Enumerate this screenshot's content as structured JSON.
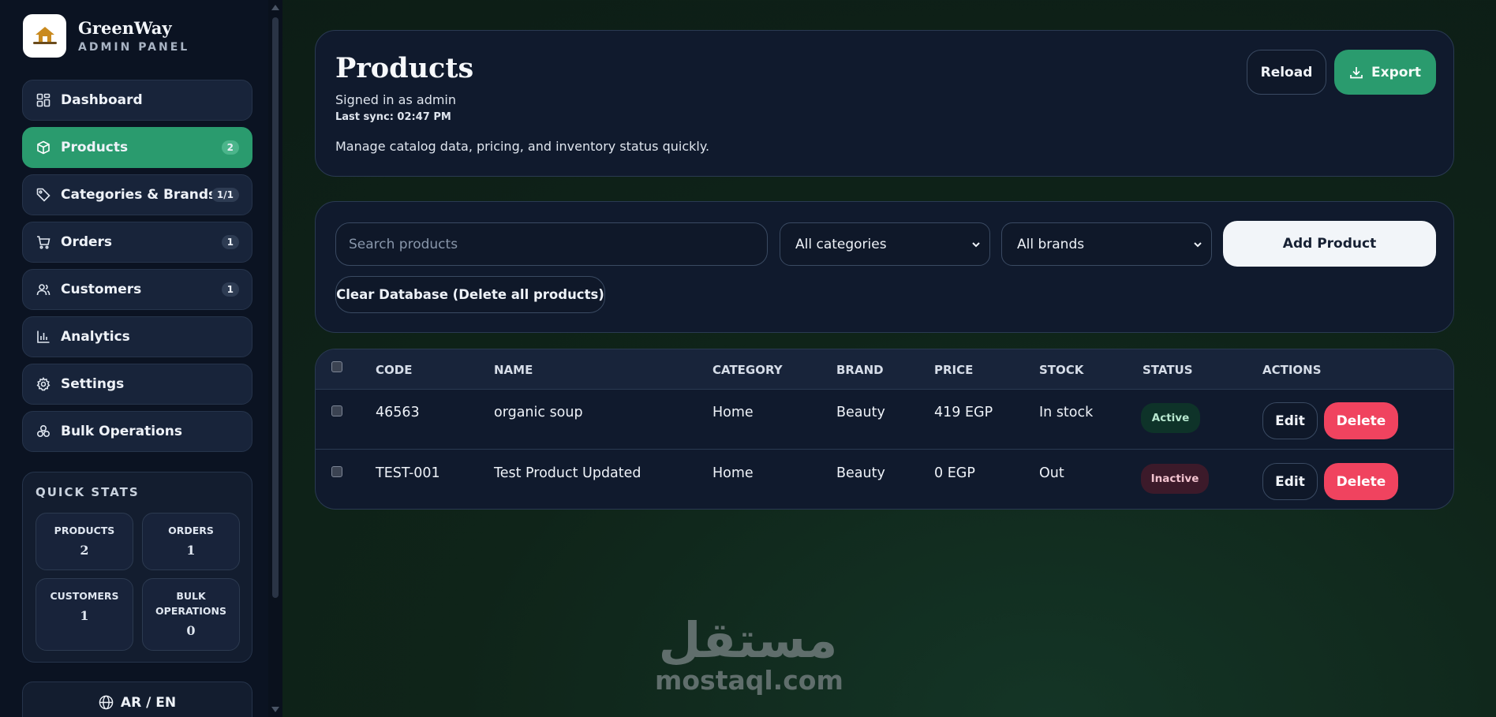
{
  "brand": {
    "name": "GreenWay",
    "subtitle": "ADMIN PANEL",
    "logo_icon": "house-logo-icon"
  },
  "sidebar": {
    "items": [
      {
        "label": "Dashboard",
        "icon": "grid-icon",
        "badge": null
      },
      {
        "label": "Products",
        "icon": "box-icon",
        "badge": "2",
        "active": true
      },
      {
        "label": "Categories & Brands",
        "icon": "tag-icon",
        "badge": "1/1"
      },
      {
        "label": "Orders",
        "icon": "cart-icon",
        "badge": "1"
      },
      {
        "label": "Customers",
        "icon": "users-icon",
        "badge": "1"
      },
      {
        "label": "Analytics",
        "icon": "bar-chart-icon",
        "badge": null
      },
      {
        "label": "Settings",
        "icon": "gear-icon",
        "badge": null
      },
      {
        "label": "Bulk Operations",
        "icon": "layers-icon",
        "badge": null
      }
    ],
    "quick_stats": {
      "title": "QUICK STATS",
      "products_label": "PRODUCTS",
      "products_value": "2",
      "orders_label": "ORDERS",
      "orders_value": "1",
      "customers_label": "CUSTOMERS",
      "customers_value": "1",
      "bulk_label_1": "BULK",
      "bulk_label_2": "OPERATIONS",
      "bulk_value": "0"
    },
    "language_toggle": "AR / EN"
  },
  "header": {
    "title": "Products",
    "signed_in": "Signed in as admin",
    "last_sync": "Last sync: 02:47 PM",
    "description": "Manage catalog data, pricing, and inventory status quickly.",
    "reload_label": "Reload",
    "export_label": "Export"
  },
  "filters": {
    "search_placeholder": "Search products",
    "category_selected": "All categories",
    "brand_selected": "All brands",
    "add_label": "Add Product",
    "clear_label": "Clear Database (Delete all products)"
  },
  "table": {
    "columns": [
      "CODE",
      "NAME",
      "CATEGORY",
      "BRAND",
      "PRICE",
      "STOCK",
      "STATUS",
      "ACTIONS"
    ],
    "rows": [
      {
        "code": "46563",
        "name": "organic soup",
        "category": "Home",
        "brand": "Beauty",
        "price": "419 EGP",
        "stock": "In stock",
        "status": "Active"
      },
      {
        "code": "TEST-001",
        "name": "Test Product Updated",
        "category": "Home",
        "brand": "Beauty",
        "price": "0 EGP",
        "stock": "Out",
        "status": "Inactive"
      }
    ],
    "edit_label": "Edit",
    "delete_label": "Delete"
  },
  "watermark": {
    "arabic": "مستقل",
    "latin": "mostaql.com"
  },
  "colors": {
    "accent": "#2a9b6e",
    "danger": "#f0435f",
    "panel": "#101a2d",
    "sidebar": "#0b1322"
  }
}
